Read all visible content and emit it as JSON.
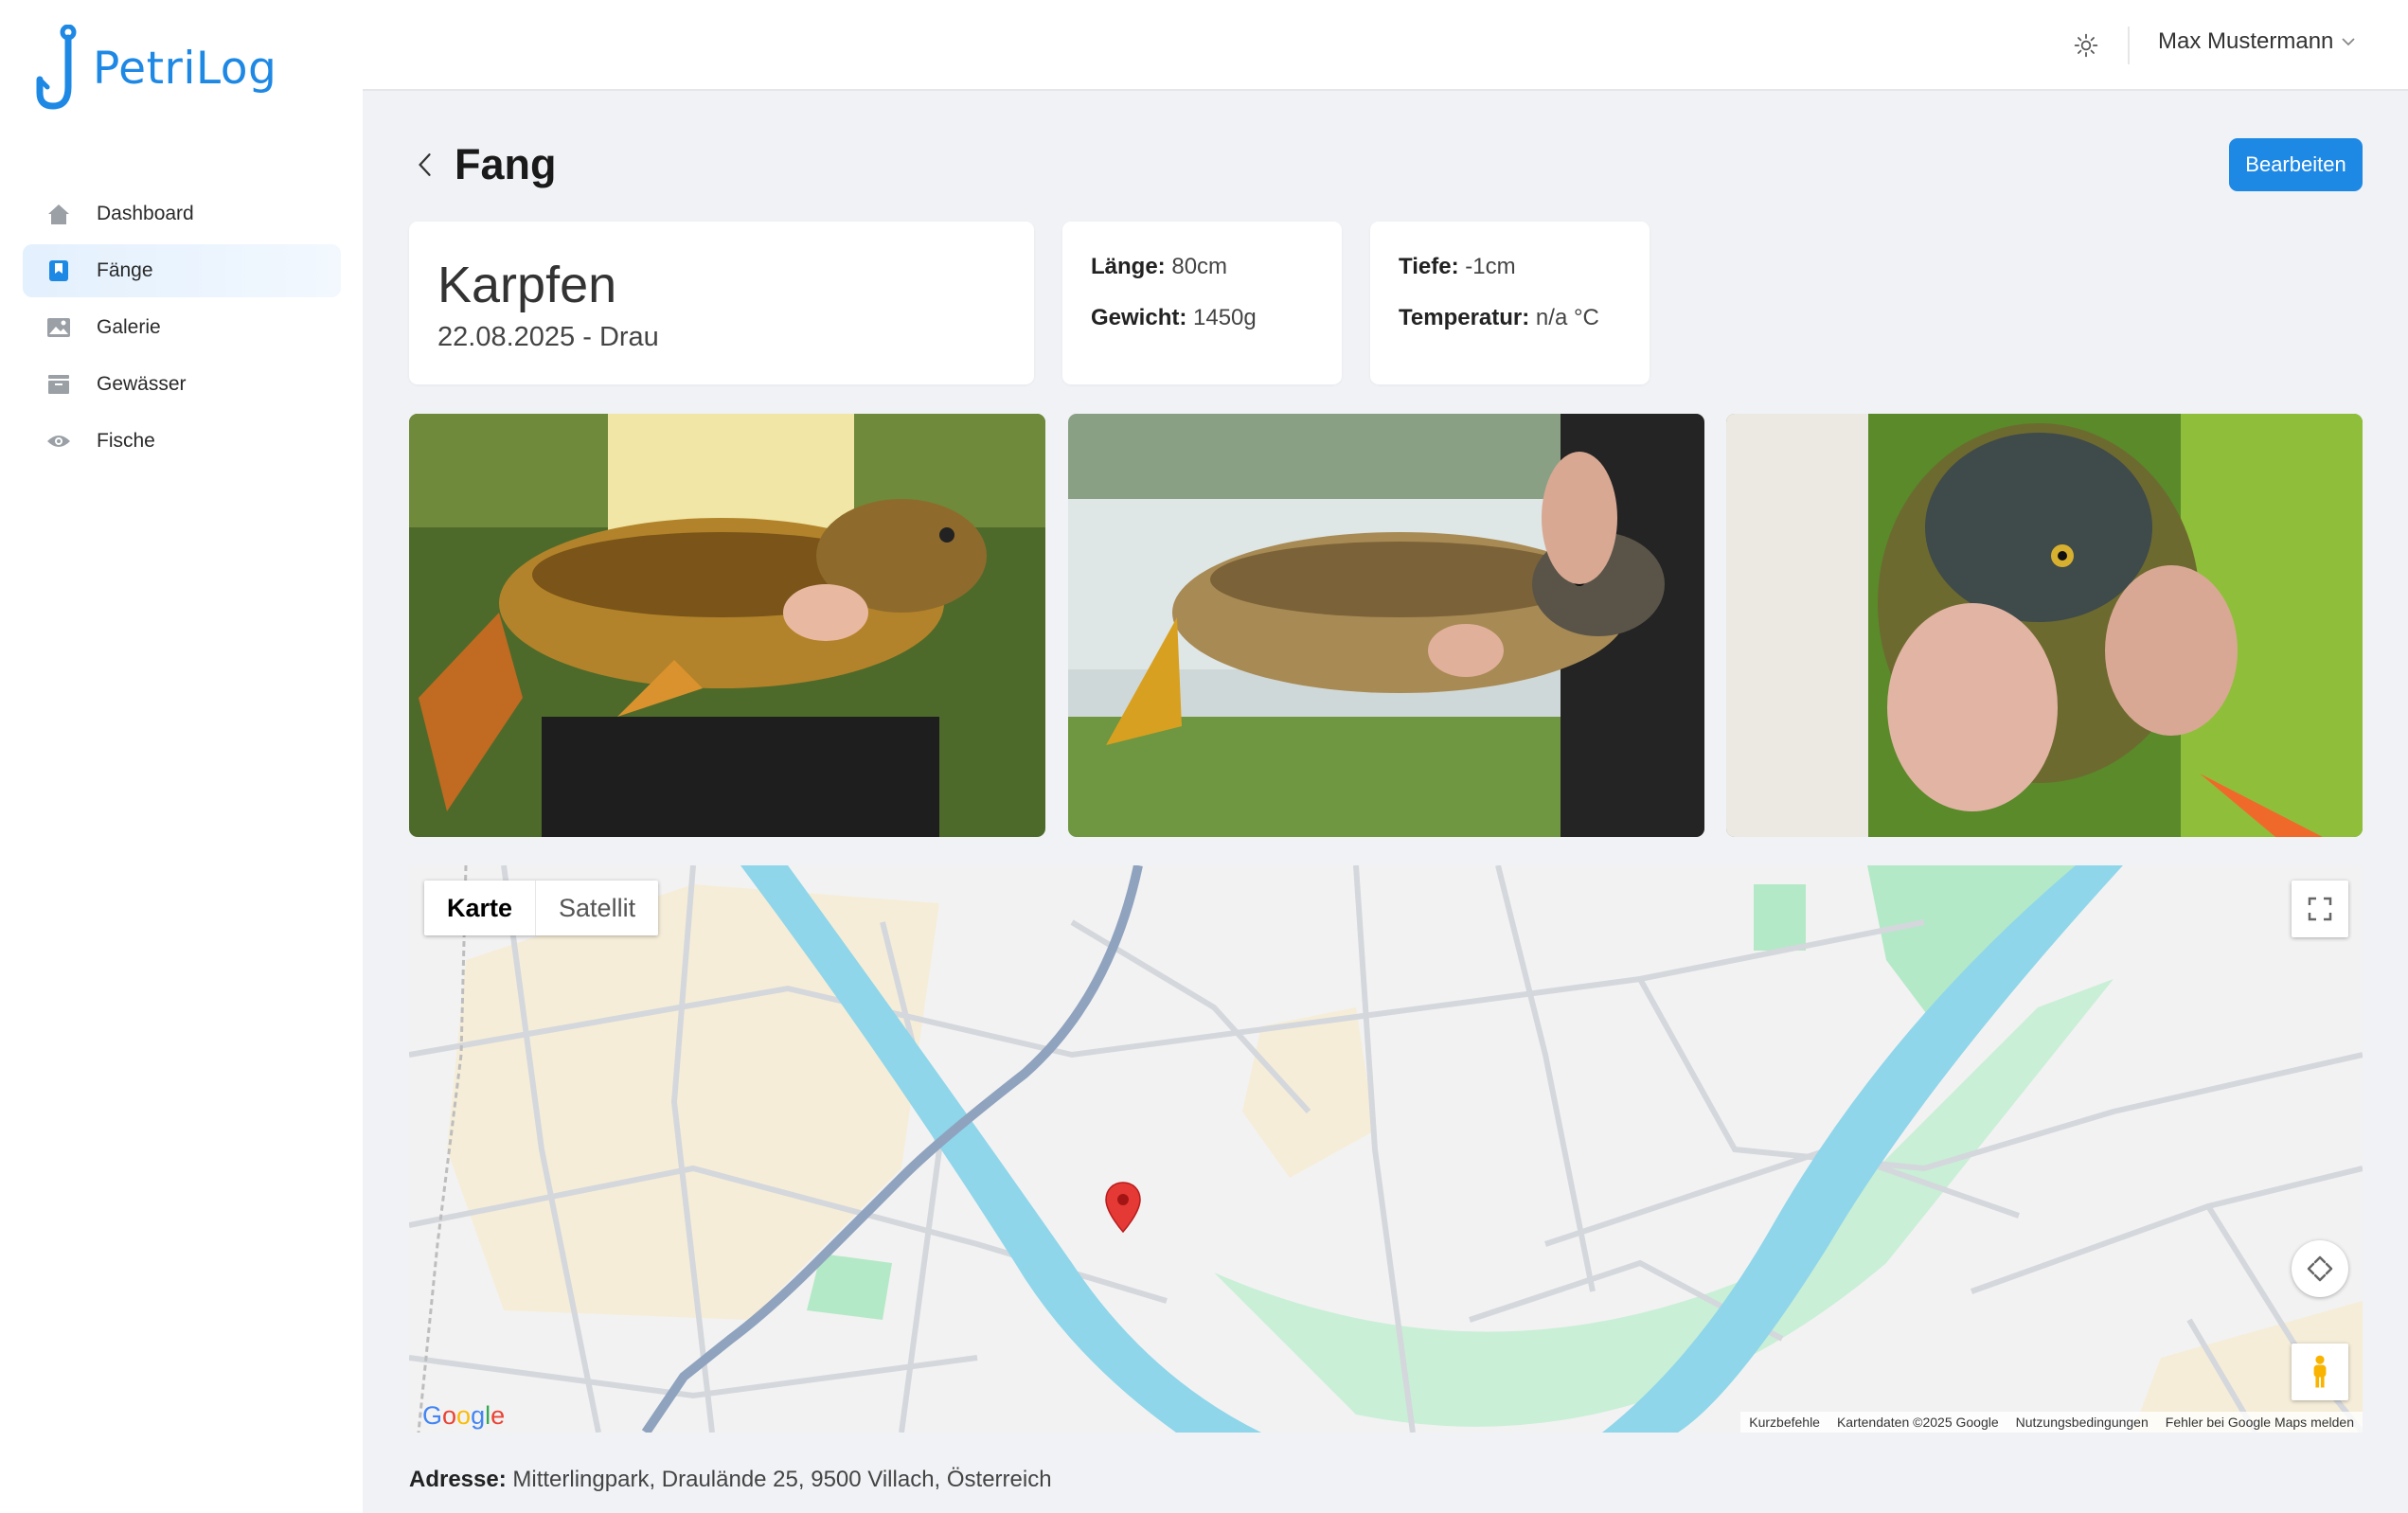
{
  "app": {
    "name": "PetriLog"
  },
  "colors": {
    "accent": "#1e88e5",
    "water": "#8fd6ea",
    "park": "#b4e9c7",
    "marker": "#e53935"
  },
  "sidebar": {
    "items": [
      {
        "label": "Dashboard",
        "icon": "home-icon",
        "active": false
      },
      {
        "label": "Fänge",
        "icon": "bookmark-icon",
        "active": true
      },
      {
        "label": "Galerie",
        "icon": "image-icon",
        "active": false
      },
      {
        "label": "Gewässer",
        "icon": "archive-icon",
        "active": false
      },
      {
        "label": "Fische",
        "icon": "eye-icon",
        "active": false
      }
    ]
  },
  "header": {
    "theme_icon": "sun-icon",
    "user_name": "Max Mustermann"
  },
  "page": {
    "title": "Fang",
    "edit_label": "Bearbeiten"
  },
  "catch": {
    "species": "Karpfen",
    "date": "22.08.2025",
    "separator": " - ",
    "water": "Drau",
    "length_label": "Länge:",
    "length_value": "80cm",
    "weight_label": "Gewicht:",
    "weight_value": "1450g",
    "depth_label": "Tiefe:",
    "depth_value": "-1cm",
    "temperature_label": "Temperatur:",
    "temperature_value": "n/a °C"
  },
  "photos": [
    {
      "alt": "carp-photo-1"
    },
    {
      "alt": "carp-photo-2"
    },
    {
      "alt": "carp-photo-3"
    }
  ],
  "map": {
    "type_buttons": [
      "Karte",
      "Satellit"
    ],
    "active_type": "Karte",
    "google_logo": "Google",
    "attribution": [
      "Kurzbefehle",
      "Kartendaten ©2025 Google",
      "Nutzungsbedingungen",
      "Fehler bei Google Maps melden"
    ]
  },
  "address": {
    "label": "Adresse:",
    "value": "Mitterlingpark, Draulände 25, 9500 Villach, Österreich"
  }
}
